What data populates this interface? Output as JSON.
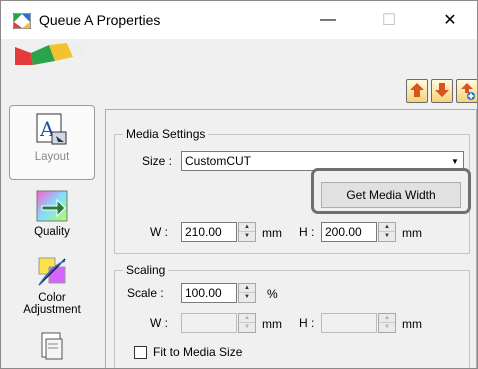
{
  "window": {
    "title": "Queue A Properties",
    "minimize_glyph": "—",
    "maximize_glyph": "☐",
    "close_glyph": "✕"
  },
  "toolbar": {
    "icons": [
      "import-settings-icon",
      "export-settings-icon",
      "add-settings-icon"
    ]
  },
  "nav": {
    "items": [
      {
        "label": "Layout",
        "icon": "layout-icon",
        "selected": true
      },
      {
        "label": "Quality",
        "icon": "quality-icon",
        "selected": false
      },
      {
        "label": "Color Adjustment",
        "label_line1": "Color",
        "label_line2": "Adjustment",
        "icon": "color-adjustment-icon",
        "selected": false
      },
      {
        "label": "",
        "icon": "file-format-icon",
        "selected": false
      }
    ]
  },
  "media_settings": {
    "group_title": "Media Settings",
    "size_label": "Size :",
    "size_value": "CustomCUT",
    "get_media_width_label": "Get Media Width",
    "w_label": "W :",
    "w_value": "210.00",
    "w_unit": "mm",
    "h_label": "H :",
    "h_value": "200.00",
    "h_unit": "mm"
  },
  "scaling": {
    "group_title": "Scaling",
    "scale_label": "Scale :",
    "scale_value": "100.00",
    "scale_unit": "%",
    "w_label": "W :",
    "w_value": "",
    "w_unit": "mm",
    "h_label": "H :",
    "h_value": "",
    "h_unit": "mm",
    "fit_label": "Fit to Media Size",
    "fit_checked": false
  },
  "colors": {
    "highlight_border": "#707070"
  }
}
